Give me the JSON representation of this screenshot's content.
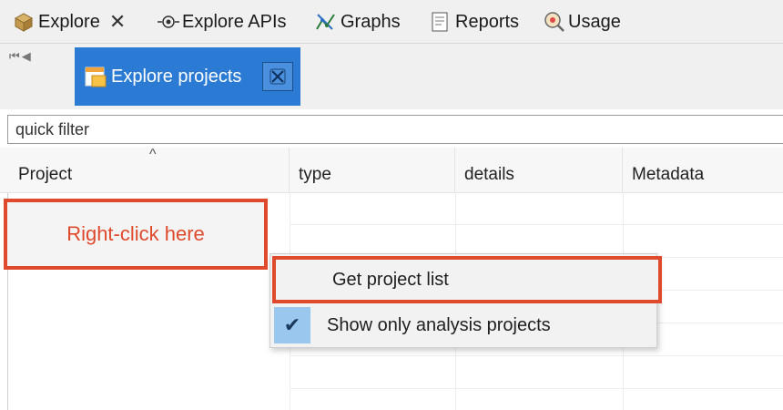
{
  "tabs": [
    {
      "label": "Explore",
      "icon": "package-icon",
      "closable": true
    },
    {
      "label": "Explore APIs",
      "icon": "eye-icon"
    },
    {
      "label": "Graphs",
      "icon": "graph-icon"
    },
    {
      "label": "Reports",
      "icon": "report-icon"
    },
    {
      "label": "Usage",
      "icon": "magnifier-icon"
    }
  ],
  "subtab": {
    "label": "Explore projects",
    "icon": "projects-icon",
    "close_icon": "close-icon"
  },
  "filter": {
    "value": "quick filter"
  },
  "columns": [
    "Project",
    "type",
    "details",
    "Metadata"
  ],
  "annotation": {
    "text": "Right-click here",
    "color": "#e04a2c"
  },
  "context_menu": {
    "items": [
      {
        "label": "Get project list",
        "checked": false,
        "highlighted": true
      },
      {
        "label": "Show only analysis projects",
        "checked": true
      }
    ]
  },
  "colors": {
    "accent": "#2b7bd4",
    "annotation": "#e04a2c",
    "check_bg": "#9ac7ee"
  }
}
